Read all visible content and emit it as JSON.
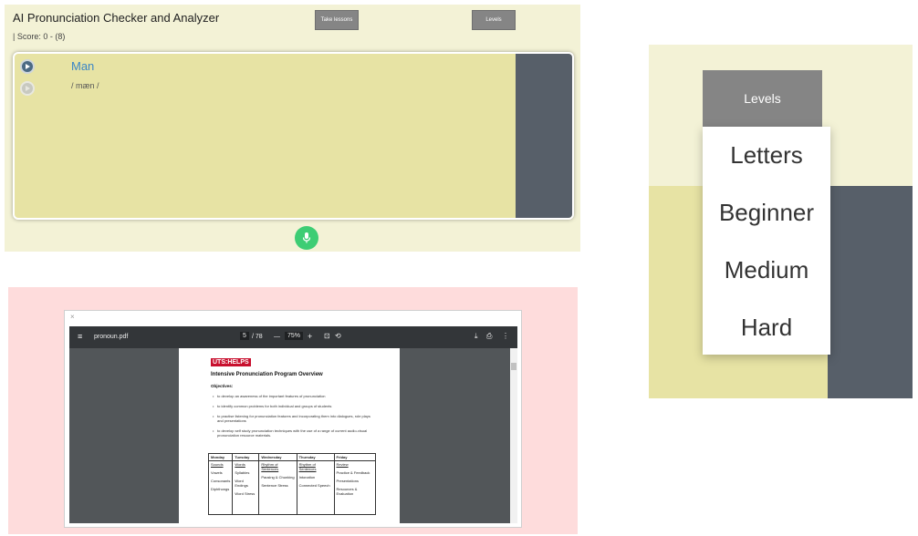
{
  "app": {
    "title": "AI Pronunciation Checker and Analyzer",
    "score": "| Score: 0 - (8)",
    "take_lessons_label": "Take lessons",
    "levels_label": "Levels",
    "word": "Man",
    "ipa": "/ mæn /",
    "play_icon": "play-icon",
    "mic_icon": "microphone-icon",
    "colors": {
      "background": "#f3f2d6",
      "card": "#e7e3a4",
      "side": "#575f69",
      "accent": "#3dcd74",
      "word": "#3b86c6"
    }
  },
  "pdf": {
    "close": "×",
    "filename": "pronoun.pdf",
    "page_current": "5",
    "page_total": "/ 78",
    "zoom_minus": "—",
    "zoom": "75%",
    "zoom_plus": "+",
    "badge": "UTS:HELPS",
    "doc_title": "Intensive Pronunciation Program Overview",
    "objectives_label": "Objectives:",
    "objectives": [
      "to develop an awareness of the important features of pronunciation",
      "to identify common problems for both individual and groups of students",
      "to practise listening for pronunciation features and incorporating them into dialogues, role plays and presentations",
      "to develop self study pronunciation techniques with the use of a range of current audio-visual pronunciation resource materials."
    ],
    "table": {
      "headers": [
        "Monday",
        "Tuesday",
        "Wednesday",
        "Thursday",
        "Friday"
      ],
      "columns": [
        [
          "Sounds",
          "Vowels",
          "Consonants",
          "Diphthongs"
        ],
        [
          "Words",
          "Syllables",
          "Word Endings",
          "Word Stress"
        ],
        [
          "Rhythm of Sentences",
          "Pausing & Chunking",
          "Sentence Stress"
        ],
        [
          "Rhythm of Sentences",
          "Intonation",
          "Connected Speech"
        ],
        [
          "Review",
          "Practice & Feedback",
          "Presentations",
          "Resources & Evaluation"
        ]
      ]
    }
  },
  "dropdown": {
    "button_label": "Levels",
    "options": [
      "Letters",
      "Beginner",
      "Medium",
      "Hard"
    ]
  }
}
